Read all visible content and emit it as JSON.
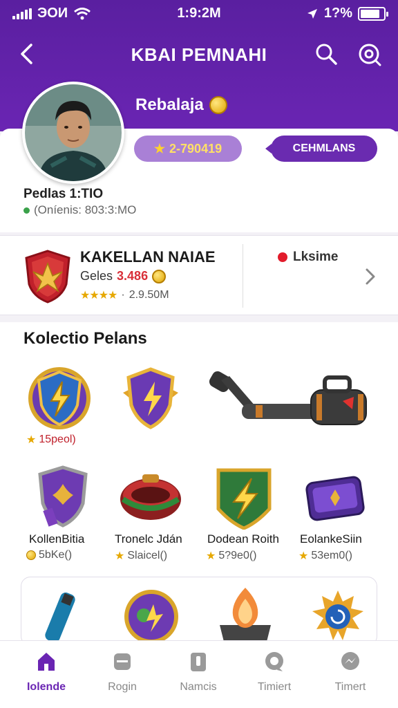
{
  "status_bar": {
    "carrier": "ЭOИ",
    "time": "1:9:2M",
    "battery_text": "1?%"
  },
  "nav": {
    "title": "KBAI PEMNAHI"
  },
  "profile": {
    "name": "Rebalaja",
    "coins": "2-790419",
    "cta_label": "CEHMLANS",
    "meta_line1": "Pedlas 1:TIO",
    "meta_line2": "(Oníenis: 803:3:MO"
  },
  "club": {
    "name": "KAKELLAN NAIAE",
    "line2_label": "Geles",
    "line2_value": "3.486",
    "rating_stars": 3.5,
    "line3_value": "2.9.50M",
    "status": "Lksime"
  },
  "collection": {
    "title": "Kolectio Pelans",
    "row1": [
      {
        "label": "",
        "sub": "15peol)",
        "icon": "crest-lightning-icon"
      },
      {
        "label": "",
        "sub": "",
        "icon": "shield-bolt-icon"
      },
      {
        "label": "",
        "sub": "",
        "icon": "cannon-icon"
      }
    ],
    "row2": [
      {
        "label": "KollenBitia",
        "sub": "5bKe()",
        "icon": "lotus-shield-icon"
      },
      {
        "label": "Tronelc Jdán",
        "sub": "Slaicel()",
        "icon": "belt-icon"
      },
      {
        "label": "Dodean Roith",
        "sub": "5?9e0()",
        "icon": "bolt-banner-icon"
      },
      {
        "label": "EolankeSiin",
        "sub": "53em0()",
        "icon": "scroll-icon"
      }
    ],
    "row3_icons": [
      "tube-icon",
      "emblem-icon",
      "fire-icon",
      "sun-icon"
    ]
  },
  "tabs": [
    {
      "label": "Iolende",
      "icon": "home-icon",
      "active": true
    },
    {
      "label": "Rogin",
      "icon": "box-icon",
      "active": false
    },
    {
      "label": "Namcis",
      "icon": "clipboard-icon",
      "active": false
    },
    {
      "label": "Timiert",
      "icon": "chat-icon",
      "active": false
    },
    {
      "label": "Timert",
      "icon": "messenger-icon",
      "active": false
    }
  ],
  "colors": {
    "brand": "#6a25b3",
    "accent_gold": "#e6a800",
    "status_red": "#e21b2b"
  }
}
